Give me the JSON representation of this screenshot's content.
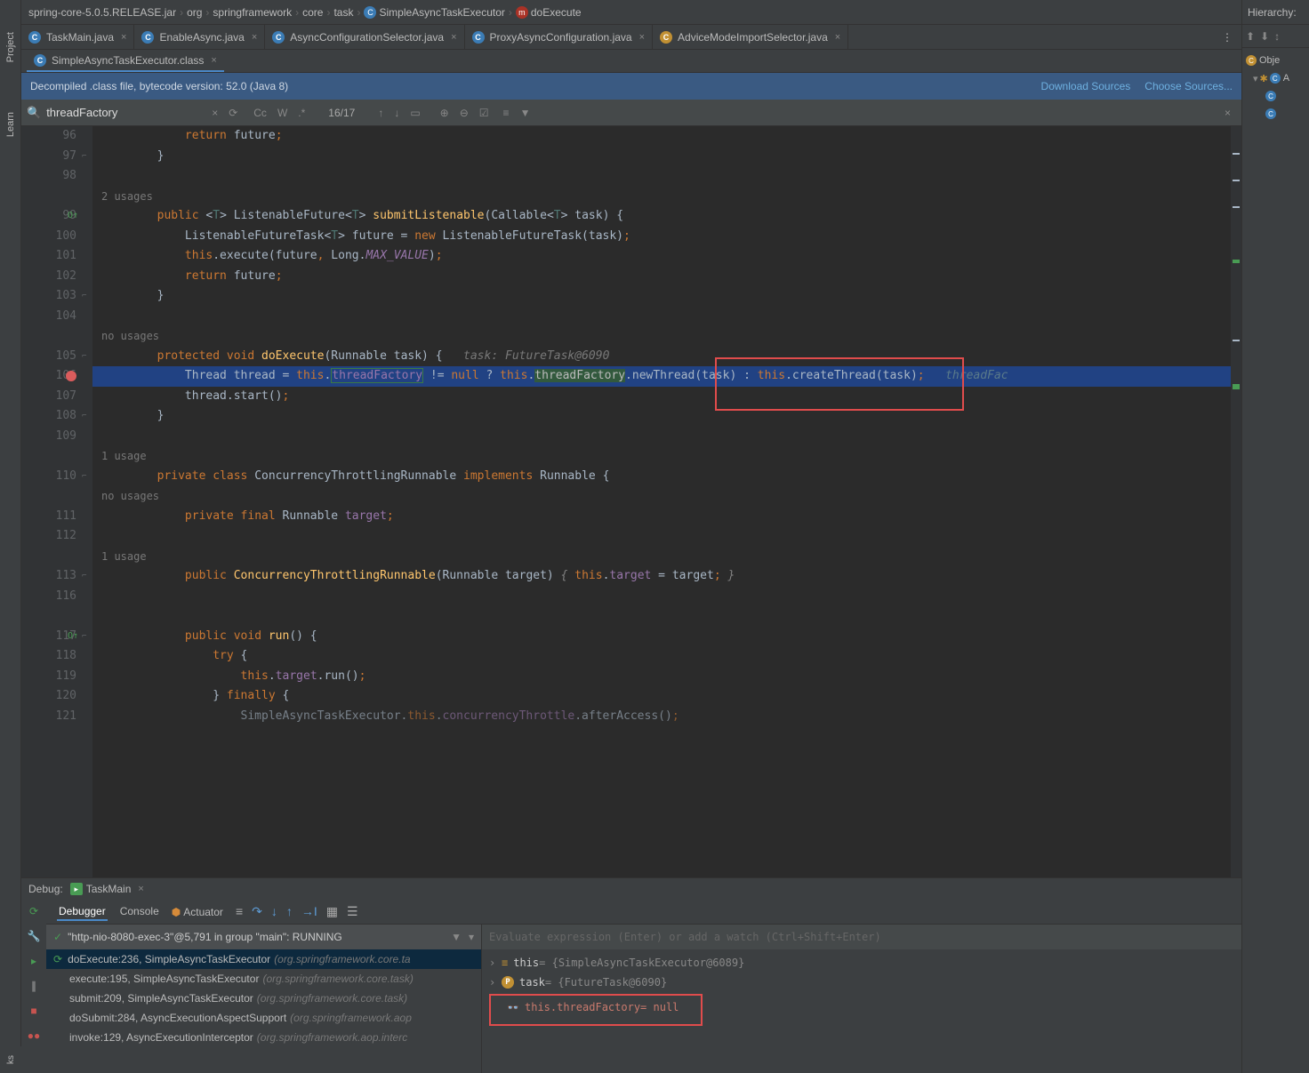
{
  "breadcrumb": {
    "jar": "spring-core-5.0.5.RELEASE.jar",
    "parts": [
      "org",
      "springframework",
      "core",
      "task"
    ],
    "class": "SimpleAsyncTaskExecutor",
    "method": "doExecute"
  },
  "tabs": [
    {
      "label": "TaskMain.java",
      "icon": "c"
    },
    {
      "label": "EnableAsync.java",
      "icon": "c"
    },
    {
      "label": "AsyncConfigurationSelector.java",
      "icon": "c"
    },
    {
      "label": "ProxyAsyncConfiguration.java",
      "icon": "c"
    },
    {
      "label": "AdviceModeImportSelector.java",
      "icon": "p"
    }
  ],
  "activeTab": {
    "label": "SimpleAsyncTaskExecutor.class",
    "icon": "c"
  },
  "decompileBar": {
    "text": "Decompiled .class file, bytecode version: 52.0 (Java 8)",
    "link1": "Download Sources",
    "link2": "Choose Sources..."
  },
  "search": {
    "value": "threadFactory",
    "count": "16/17",
    "toolCc": "Cc",
    "toolW": "W",
    "toolRegex": ".*"
  },
  "gutter": [
    "96",
    "97",
    "98",
    "",
    "99",
    "100",
    "101",
    "102",
    "103",
    "104",
    "",
    "105",
    "106",
    "107",
    "108",
    "109",
    "",
    "110",
    "",
    "111",
    "112",
    "",
    "113",
    "116",
    "",
    "117",
    "118",
    "119",
    "120",
    "121"
  ],
  "codeLines": {
    "l96": "            return future;",
    "l97": "        }",
    "hint99": "2 usages",
    "l99a": "public <T> ListenableFuture<T> submitListenable(Callable<T> task) {",
    "l100": "            ListenableFutureTask<T> future = new ListenableFutureTask(task);",
    "l101": "            this.execute(future, Long.MAX_VALUE);",
    "l102": "            return future;",
    "l103": "        }",
    "hint105": "no usages",
    "l105inlay": "task: FutureTask@6090",
    "l106trail": "threadFac",
    "l107": "            thread.start();",
    "l108": "        }",
    "hint110": "1 usage",
    "hint111": "no usages",
    "l111": "            private final Runnable target;",
    "hint113": "1 usage",
    "l117": "            public void run() {",
    "l118": "                try {",
    "l119": "                    this.target.run();",
    "l120": "                } finally {",
    "l121": "                SimpleAsyncTaskExecutor.this.concurrencyThrottle.afterAccess();"
  },
  "hierarchy": {
    "title": "Hierarchy:",
    "items": [
      {
        "icon": "p",
        "color": "#c19033",
        "label": "Obje",
        "indent": 0,
        "prefix": ""
      },
      {
        "icon": "c",
        "color": "#3b7cb5",
        "label": "A",
        "indent": 1,
        "prefix": "▾ ✱"
      },
      {
        "icon": "c",
        "color": "#3b7cb5",
        "label": "",
        "indent": 2,
        "prefix": ""
      },
      {
        "icon": "c",
        "color": "#3b7cb5",
        "label": "",
        "indent": 2,
        "prefix": ""
      }
    ]
  },
  "debug": {
    "title": "Debug:",
    "runName": "TaskMain",
    "tabs": [
      "Debugger",
      "Console"
    ],
    "actuator": "Actuator",
    "thread": "\"http-nio-8080-exec-3\"@5,791 in group \"main\": RUNNING",
    "frames": [
      {
        "text": "doExecute:236, SimpleAsyncTaskExecutor",
        "pkg": "(org.springframework.core.ta",
        "active": true
      },
      {
        "text": "execute:195, SimpleAsyncTaskExecutor",
        "pkg": "(org.springframework.core.task)"
      },
      {
        "text": "submit:209, SimpleAsyncTaskExecutor",
        "pkg": "(org.springframework.core.task)"
      },
      {
        "text": "doSubmit:284, AsyncExecutionAspectSupport",
        "pkg": "(org.springframework.aop"
      },
      {
        "text": "invoke:129, AsyncExecutionInterceptor",
        "pkg": "(org.springframework.aop.interc"
      }
    ],
    "varsPlaceholder": "Evaluate expression (Enter) or add a watch (Ctrl+Shift+Enter)",
    "vars": [
      {
        "expand": "›",
        "icon": "",
        "name": "this",
        "val": " = {SimpleAsyncTaskExecutor@6089}"
      },
      {
        "expand": "›",
        "icon": "p",
        "name": "task",
        "val": " = {FutureTask@6090}"
      }
    ],
    "watchVar": {
      "name": "this.threadFactory",
      "val": " = null"
    }
  },
  "leftSidebar": [
    "Project",
    "Learn"
  ],
  "bottomSidebar": "ks"
}
